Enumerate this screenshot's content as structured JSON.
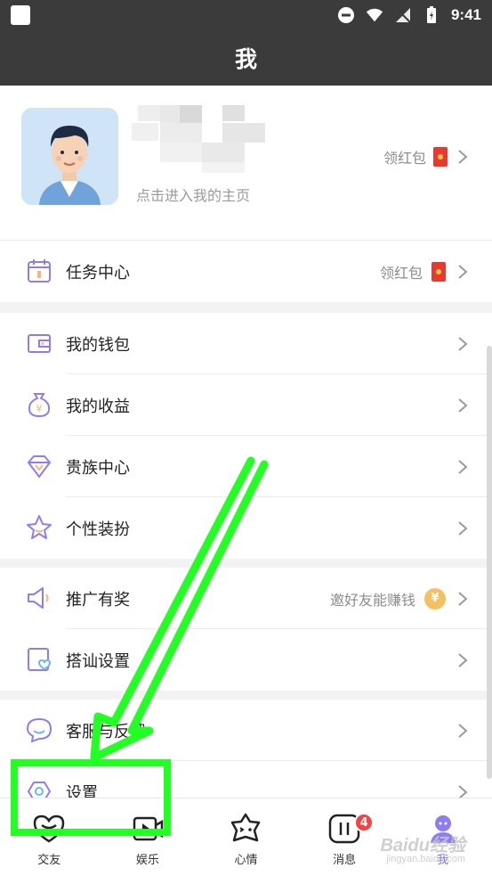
{
  "status_bar": {
    "time": "9:41"
  },
  "header": {
    "title": "我"
  },
  "profile": {
    "subtitle": "点击进入我的主页",
    "reward_label": "领红包"
  },
  "menu": {
    "task_center": {
      "label": "任务中心",
      "right": "领红包"
    },
    "wallet": {
      "label": "我的钱包"
    },
    "earnings": {
      "label": "我的收益"
    },
    "noble_center": {
      "label": "贵族中心"
    },
    "dress_up": {
      "label": "个性装扮"
    },
    "promotion": {
      "label": "推广有奖",
      "right": "邀好友能赚钱",
      "coin": "¥"
    },
    "chat_settings": {
      "label": "搭讪设置"
    },
    "support": {
      "label": "客服与反馈"
    },
    "settings": {
      "label": "设置"
    }
  },
  "bottom_nav": {
    "tabs": [
      {
        "label": "交友"
      },
      {
        "label": "娱乐"
      },
      {
        "label": "心情"
      },
      {
        "label": "消息",
        "badge": "4"
      },
      {
        "label": "我"
      }
    ]
  },
  "watermark": {
    "main": "Baidu经验",
    "sub": "jingyan.baidu.com"
  },
  "colors": {
    "header_bg": "#3b3b3b",
    "icon_purple": "#8f7cf0",
    "annotation_green": "#22ff22",
    "badge_red": "#f24444"
  }
}
